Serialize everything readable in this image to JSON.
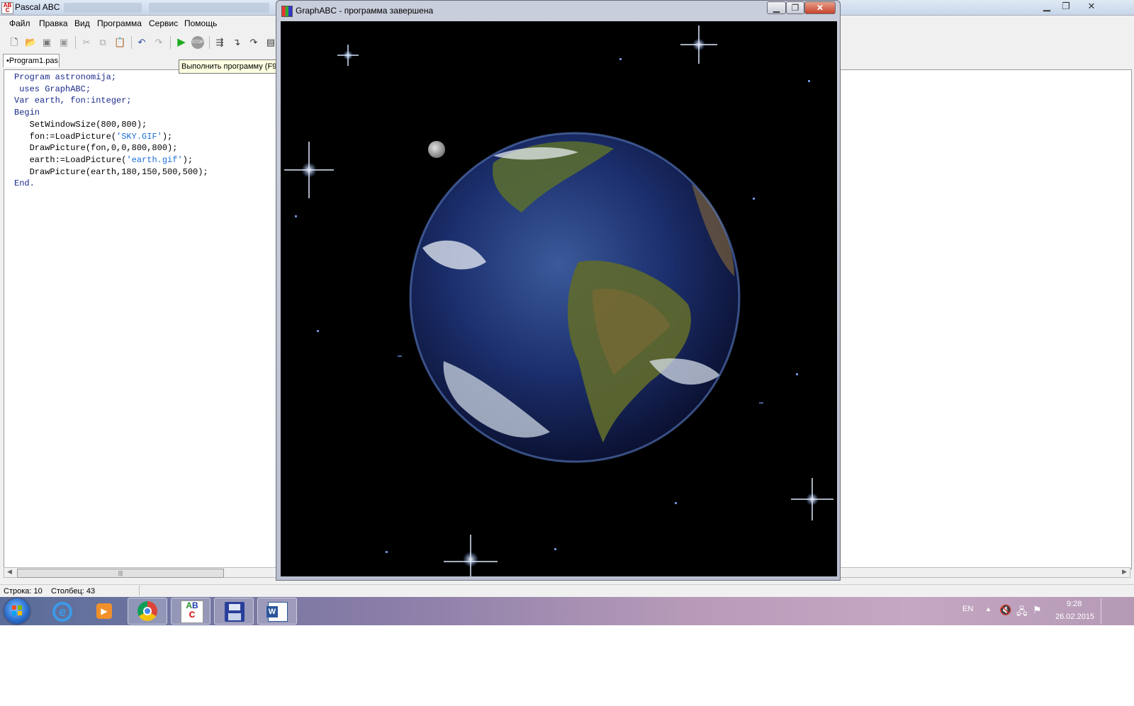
{
  "ide": {
    "title": "Pascal ABC",
    "menu": [
      "Файл",
      "Правка",
      "Вид",
      "Программа",
      "Сервис",
      "Помощь"
    ],
    "tab_label": "•Program1.pas",
    "tooltip": "Выполнить программу (F9)",
    "code_lines": [
      "Program astronomija;",
      " uses GraphABC;",
      "Var earth, fon:integer;",
      "Begin",
      "   SetWindowSize(800,800);",
      "   fon:=LoadPicture('SKY.GIF');",
      "   DrawPicture(fon,0,0,800,800);",
      "   earth:=LoadPicture('earth.gif');",
      "   DrawPicture(earth,180,150,500,500);",
      "End."
    ],
    "status_row": "Строка: 10",
    "status_col": "Столбец: 43"
  },
  "graph_window": {
    "title": "GraphABC - программа завершена"
  },
  "taskbar": {
    "lang": "EN",
    "time": "9:28",
    "date": "26.02.2015",
    "apps": [
      "internet-explorer-icon",
      "media-player-icon",
      "chrome-icon",
      "pascal-abc-icon",
      "save-disk-icon",
      "word-icon"
    ]
  },
  "colors": {
    "keyword": "#1a2a8a",
    "string": "#1e6fd9",
    "tooltip_bg": "#ffffe1",
    "canvas_bg": "#000000"
  }
}
